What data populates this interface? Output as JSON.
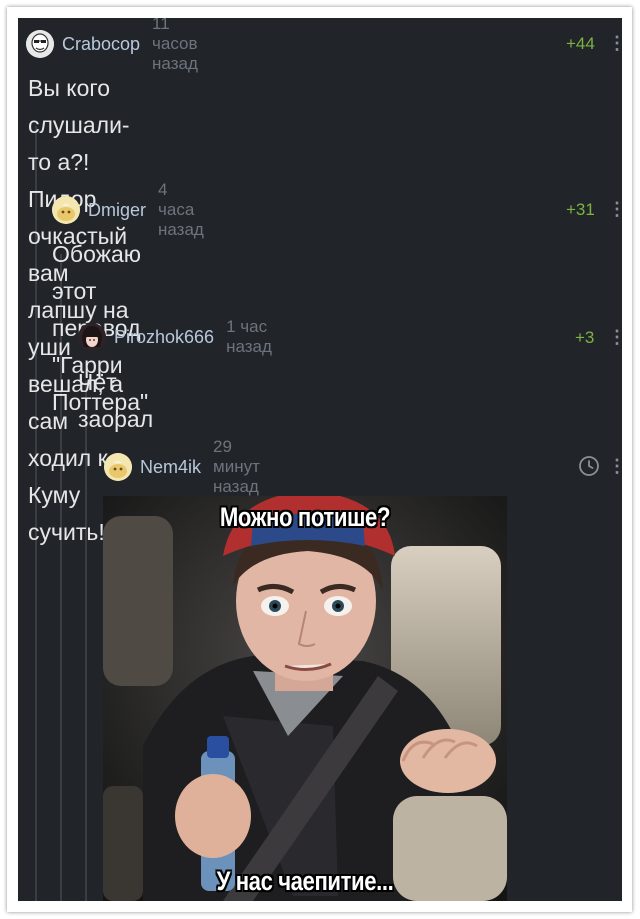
{
  "comments": [
    {
      "author": "Crabocop",
      "time": "11 часов назад",
      "rating": "+44",
      "text_lines": [
        "Вы кого слушали-то а?! Пидор очкастый вам",
        "лапшу на уши вешал, а сам ходил к Куму сучить!"
      ],
      "avatar_icon": "face-avatar-icon"
    },
    {
      "author": "Dmiger",
      "time": "4 часа назад",
      "rating": "+31",
      "text_lines": [
        "Обожаю этот перевод \"Гарри Поттера\""
      ],
      "avatar_icon": "default-avatar-icon"
    },
    {
      "author": "Pirozhok666",
      "time": "1 час назад",
      "rating": "+3",
      "text_lines": [
        "Чёт заорал"
      ],
      "avatar_icon": "anime-avatar-icon"
    },
    {
      "author": "Nem4ik",
      "time": "29 минут назад",
      "rating_icon": "clock-icon",
      "avatar_icon": "default-avatar-icon",
      "meme": {
        "top_caption": "Можно потише?",
        "bottom_caption": "У нас чаепитие..."
      }
    }
  ],
  "more_icon": "vertical-dots-icon",
  "colors": {
    "background": "#212428",
    "author": "#b8c8dc",
    "time": "#6d747d",
    "rating_positive": "#7cb342",
    "text": "#e4e6e8",
    "thread_line": "#3a3e44"
  }
}
